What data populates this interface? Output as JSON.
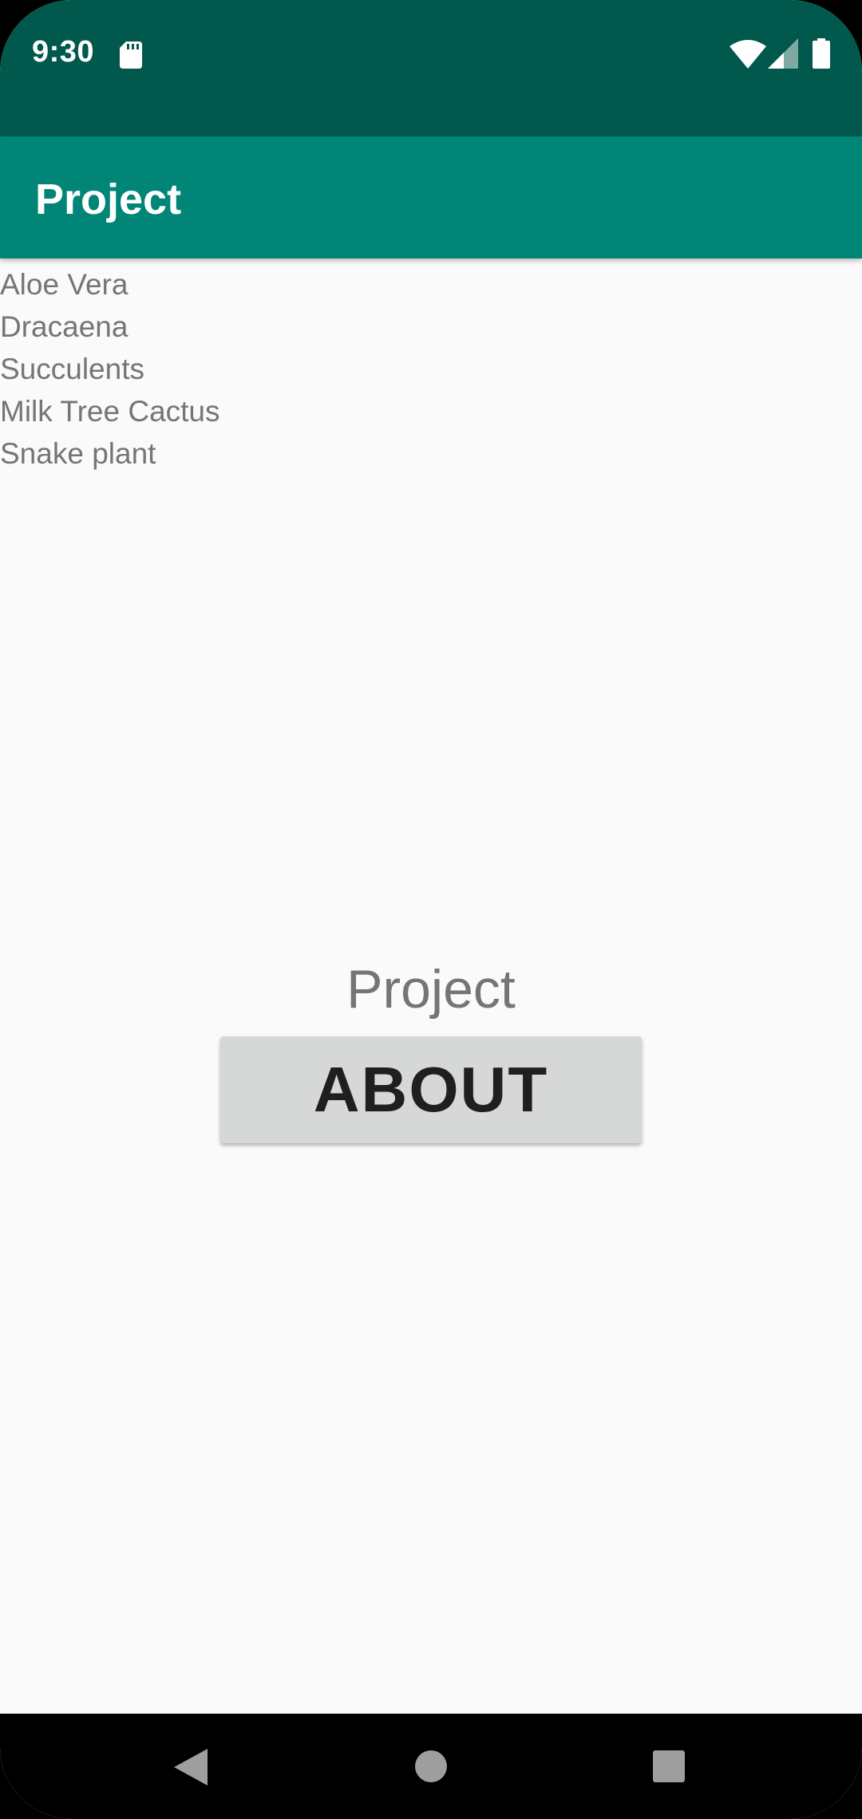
{
  "status_bar": {
    "time": "9:30",
    "icons": [
      "sd-card-icon",
      "wifi-icon",
      "cell-signal-icon",
      "battery-icon"
    ],
    "background_color": "#00594c"
  },
  "app_bar": {
    "title": "Project",
    "background_color": "#008577"
  },
  "plants": [
    "Aloe Vera",
    "Dracaena",
    "Succulents",
    "Milk Tree Cactus",
    "Snake plant"
  ],
  "main": {
    "label": "Project",
    "about_button_label": "ABOUT"
  },
  "nav_bar": {
    "icons": [
      "back-icon",
      "home-icon",
      "recents-icon"
    ]
  }
}
